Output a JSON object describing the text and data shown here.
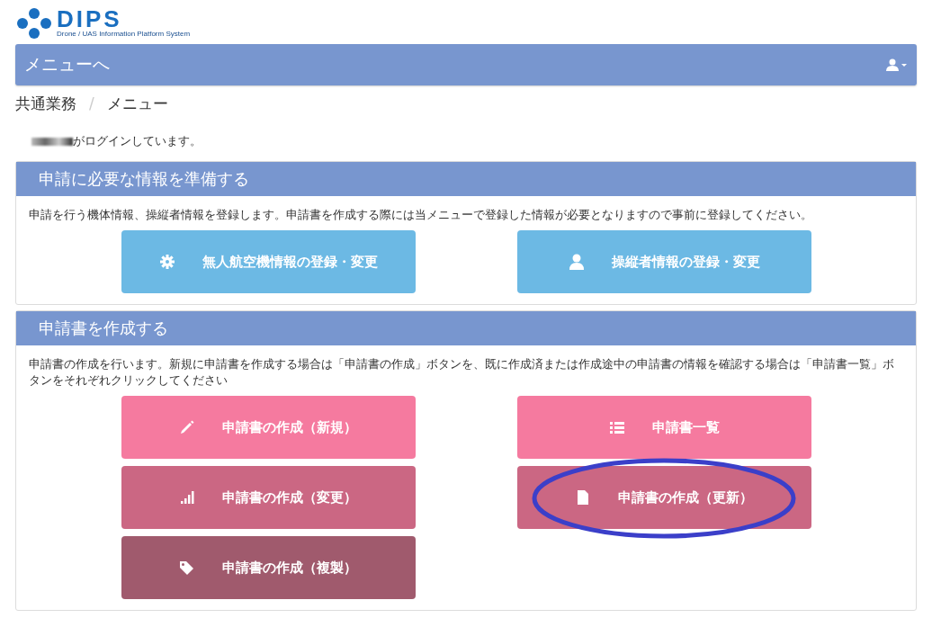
{
  "logo": {
    "name": "DIPS",
    "tagline": "Drone / UAS Information Platform System"
  },
  "navbar": {
    "title": "メニューへ"
  },
  "breadcrumb": [
    "共通業務",
    "メニュー"
  ],
  "breadcrumb_separator": "/",
  "login_message": "がログインしています。",
  "panels": [
    {
      "title": "申請に必要な情報を準備する",
      "description": "申請を行う機体情報、操縦者情報を登録します。申請書を作成する際には当メニューで登録した情報が必要となりますので事前に登録してください。",
      "buttons": [
        {
          "label": "無人航空機情報の登録・変更",
          "kind": "gear",
          "color": "#6cb9e4",
          "highlighted": false
        },
        {
          "label": "操縦者情報の登録・変更",
          "kind": "user",
          "color": "#6cb9e4",
          "highlighted": false
        }
      ]
    },
    {
      "title": "申請書を作成する",
      "description": "申請書の作成を行います。新規に申請書を作成する場合は「申請書の作成」ボタンを、既に作成済または作成途中の申請書の情報を確認する場合は「申請書一覧」ボタンをそれぞれクリックしてください",
      "buttons": [
        {
          "label": "申請書の作成（新規）",
          "kind": "pencil",
          "color": "#f57a9f",
          "highlighted": false
        },
        {
          "label": "申請書一覧",
          "kind": "list",
          "color": "#f57a9f",
          "highlighted": false
        },
        {
          "label": "申請書の作成（変更）",
          "kind": "signal",
          "color": "#cb6783",
          "highlighted": false
        },
        {
          "label": "申請書の作成（更新）",
          "kind": "file",
          "color": "#cb6783",
          "highlighted": true
        },
        {
          "label": "申請書の作成（複製）",
          "kind": "tags",
          "color": "#a05a6d",
          "highlighted": false
        }
      ]
    }
  ]
}
